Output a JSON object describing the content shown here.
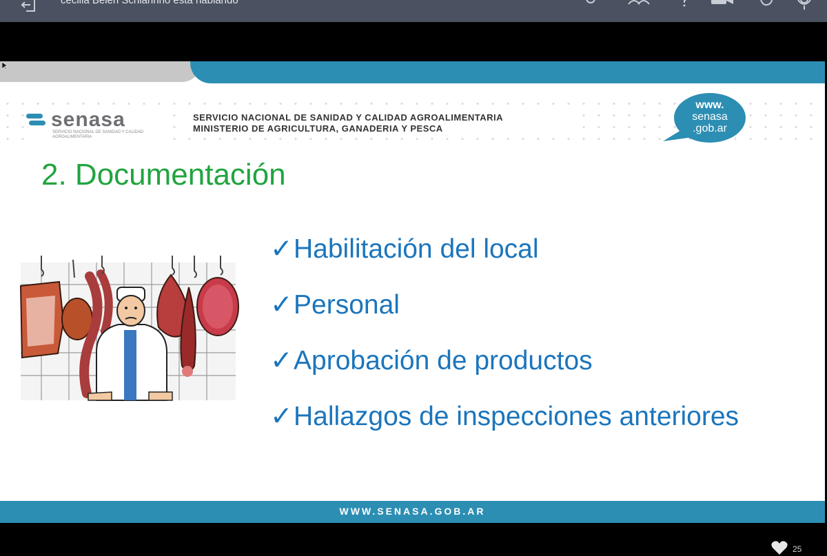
{
  "topbar": {
    "speaking_text": "cecilia Belén Schiarinno está hablando",
    "icons": [
      "exit-icon",
      "settings-icon",
      "participants-icon",
      "help-icon",
      "camera-icon",
      "raise-hand-icon",
      "microphone-icon"
    ]
  },
  "slide": {
    "logo_text": "senasa",
    "logo_subtext": "SERVICIO NACIONAL DE SANIDAD Y CALIDAD AGROALIMENTARIA",
    "org_line1": "SERVICIO NACIONAL DE SANIDAD Y CALIDAD AGROALIMENTARIA",
    "org_line2": "MINISTERIO DE AGRICULTURA, GANADERIA Y PESCA",
    "bubble": {
      "line1": "www.",
      "line2": "senasa",
      "line3": ".gob.ar"
    },
    "title": "2. Documentación",
    "bullets": [
      "Habilitación del local",
      "Personal",
      "Aprobación de productos",
      "Hallazgos de inspecciones anteriores"
    ],
    "check_glyph": "✓",
    "footer_url": "WWW.SENASA.GOB.AR"
  },
  "footer": {
    "count": "25"
  },
  "colors": {
    "topbar": "#4a5160",
    "accent_blue": "#2d8eb3",
    "title_green": "#21a43f",
    "bullet_blue": "#1b75bc"
  }
}
